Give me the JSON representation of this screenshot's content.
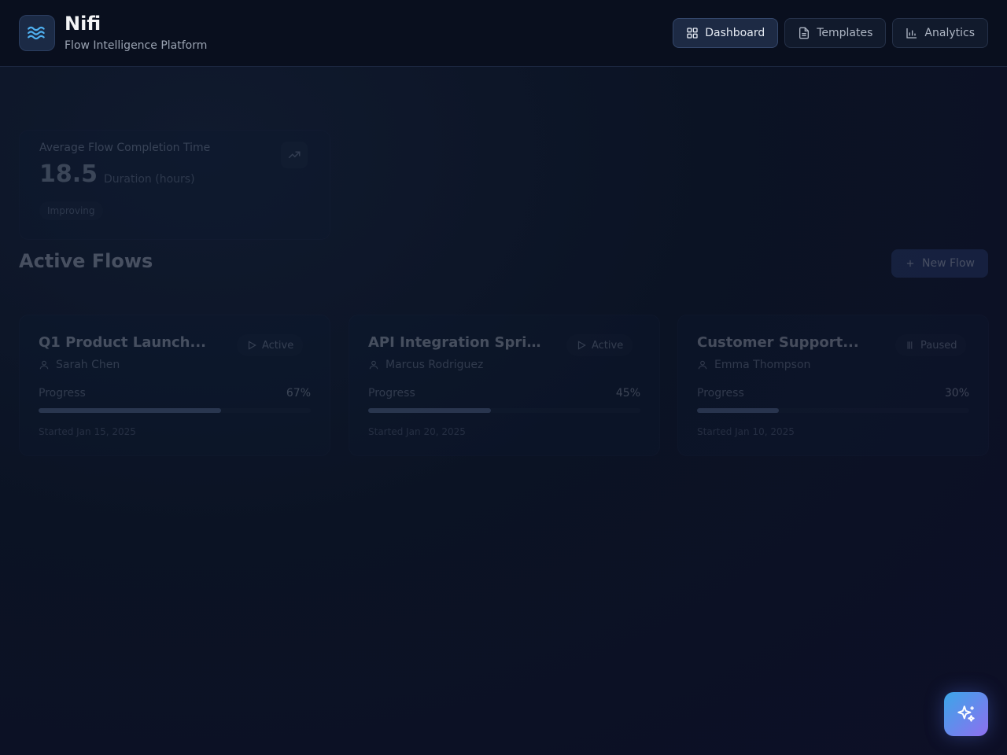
{
  "header": {
    "title": "Nifi",
    "subtitle": "Flow Intelligence Platform",
    "logo_icon": "waves-icon",
    "nav": [
      {
        "label": "Dashboard",
        "icon": "grid-icon",
        "active": true
      },
      {
        "label": "Templates",
        "icon": "document-icon",
        "active": false
      },
      {
        "label": "Analytics",
        "icon": "bar-chart-icon",
        "active": false
      }
    ]
  },
  "stat": {
    "label": "Average Flow Completion Time",
    "value": "18.5",
    "unit": "Duration (hours)",
    "badge": "Improving",
    "icon": "trend-up-icon"
  },
  "flows_section": {
    "title": "Active Flows",
    "new_button": "New Flow",
    "items": [
      {
        "title": "Q1 Product Launch...",
        "status": "Active",
        "status_icon": "play-icon",
        "owner": "Sarah Chen",
        "progress_label": "Progress",
        "progress": "67%",
        "progress_value": 0.67,
        "started": "Started Jan 15, 2025"
      },
      {
        "title": "API Integration Sprint",
        "status": "Active",
        "status_icon": "play-icon",
        "owner": "Marcus Rodriguez",
        "progress_label": "Progress",
        "progress": "45%",
        "progress_value": 0.45,
        "started": "Started Jan 20, 2025"
      },
      {
        "title": "Customer Support...",
        "status": "Paused",
        "status_icon": "pause-icon",
        "owner": "Emma Thompson",
        "progress_label": "Progress",
        "progress": "30%",
        "progress_value": 0.3,
        "started": "Started Jan 10, 2025"
      }
    ]
  },
  "fab": {
    "icon": "sparkles-icon"
  },
  "colors": {
    "background": "#0b1324",
    "accent_start": "#3ba6e8",
    "accent_end": "#8e6ff0",
    "primary_button": "#2c4478"
  }
}
